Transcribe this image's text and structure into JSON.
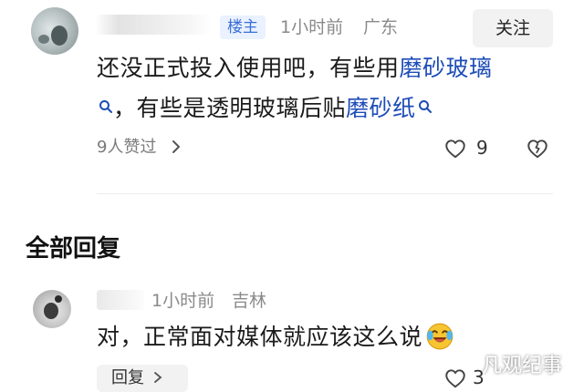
{
  "post": {
    "badge": "楼主",
    "time": "1小时前",
    "location": "广东",
    "follow_label": "关注",
    "content_part1": "还没正式投入使用吧，有些用",
    "link1": "磨砂玻璃",
    "content_part2": "，有些是透明玻璃后贴",
    "link2": "磨砂纸",
    "likes_label": "9人赞过",
    "like_count": "9"
  },
  "replies_section": {
    "title": "全部回复"
  },
  "reply": {
    "time": "1小时前",
    "location": "吉林",
    "content": "对，正常面对媒体就应该这么说",
    "reply_button": "回复",
    "like_count": "3"
  },
  "watermark": "凡观纪事",
  "colors": {
    "link": "#1e4db7",
    "badge_bg": "#eaf1ff",
    "badge_text": "#3a6fd8",
    "muted": "#8a8a8a"
  }
}
